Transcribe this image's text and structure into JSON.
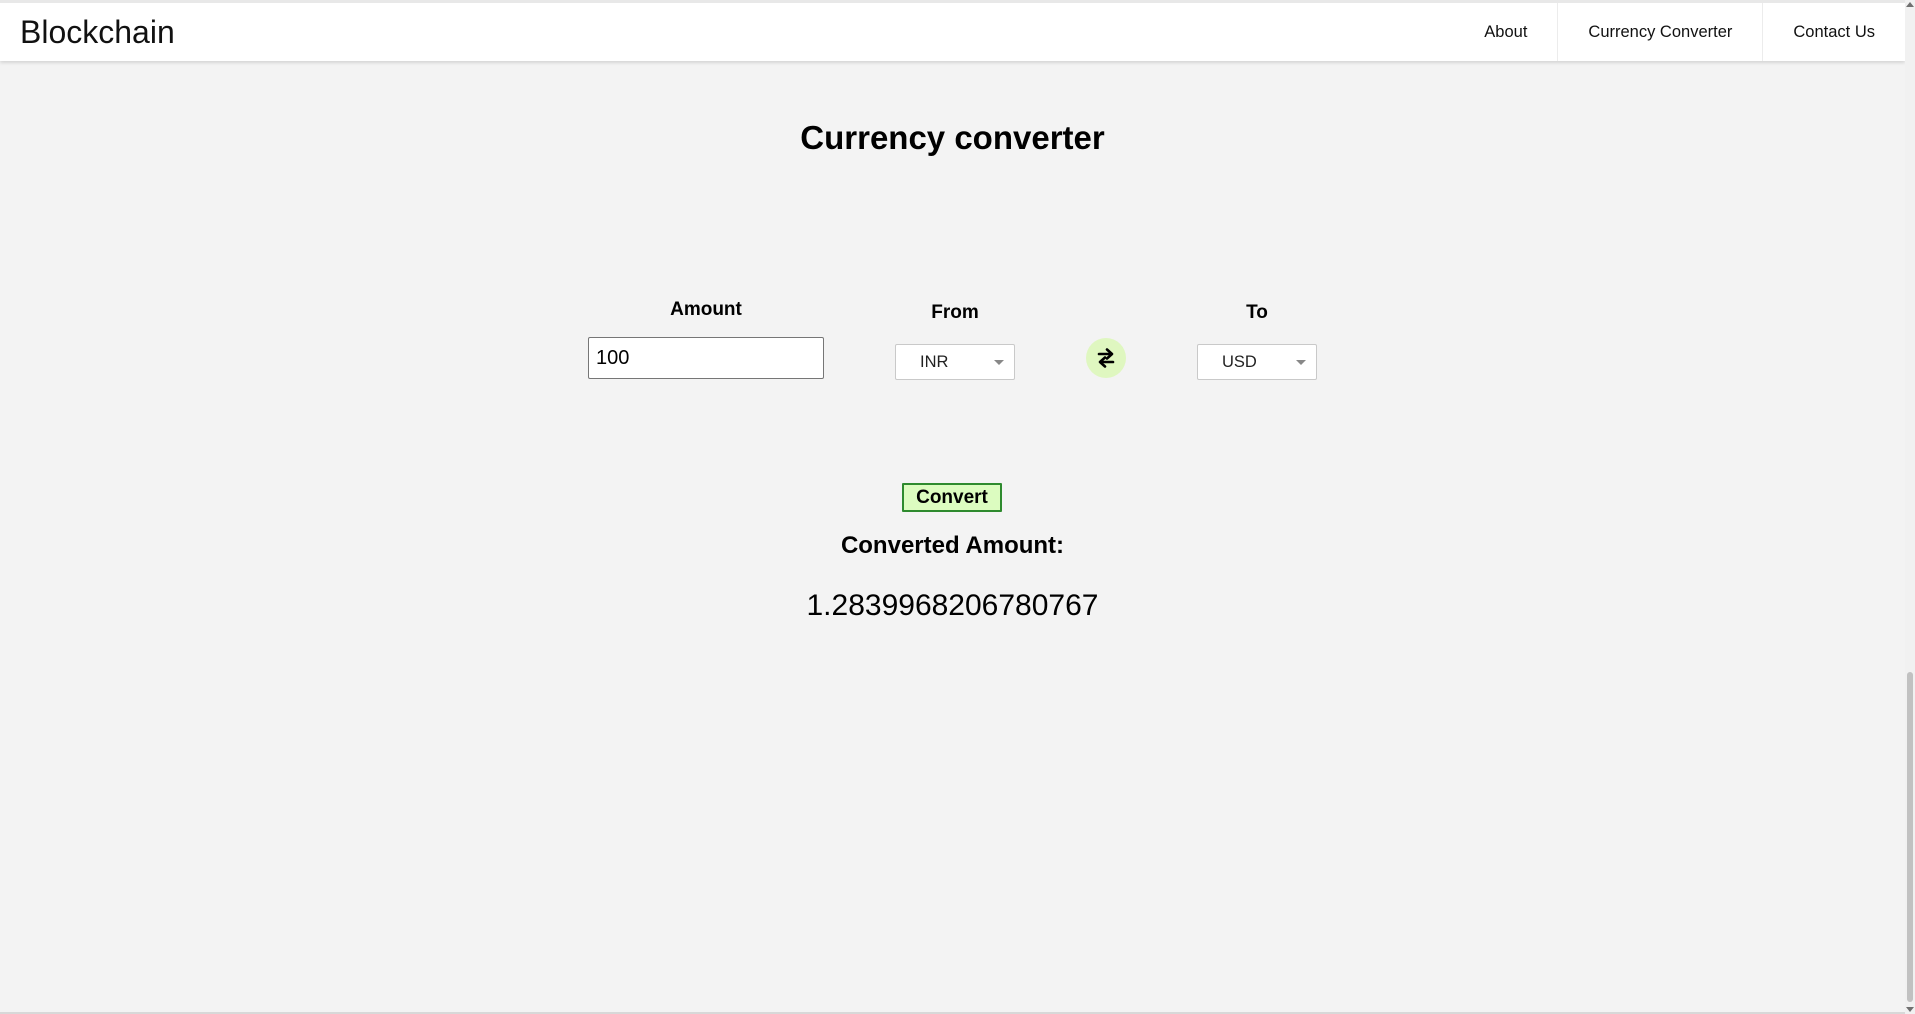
{
  "navbar": {
    "brand": "Blockchain",
    "links": [
      "About",
      "Currency Converter",
      "Contact Us"
    ]
  },
  "converter": {
    "title": "Currency converter",
    "amount_label": "Amount",
    "amount_value": "100",
    "from_label": "From",
    "from_value": "INR",
    "to_label": "To",
    "to_value": "USD",
    "swap_icon": "swap-arrows-icon",
    "convert_label": "Convert",
    "result_label": "Converted Amount:",
    "result_value": "1.2839968206780767"
  },
  "colors": {
    "accent_green_light": "#dcfcc0",
    "accent_green_border": "#2e8a2e",
    "page_background": "#f3f3f3"
  }
}
